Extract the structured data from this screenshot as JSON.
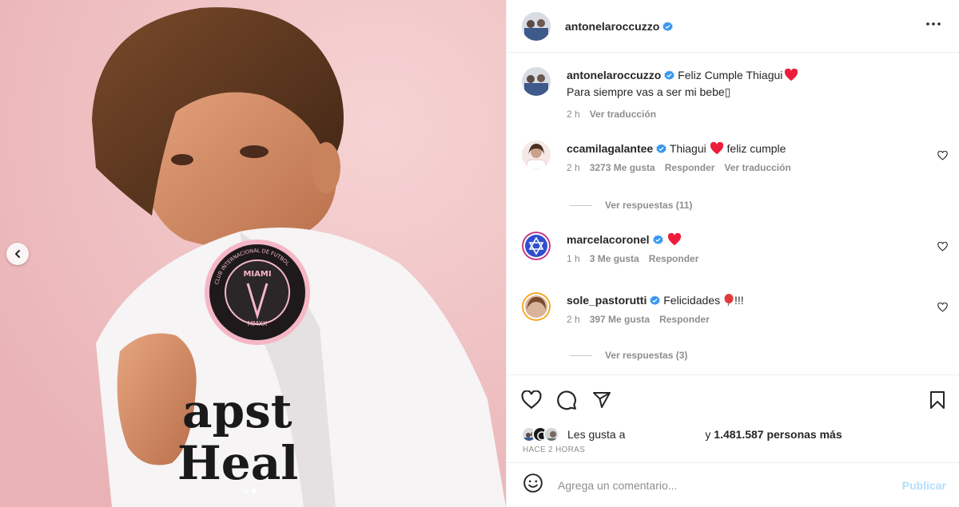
{
  "header": {
    "username": "antonelaroccuzzo",
    "verified": true,
    "more_icon": "more-horizontal-icon"
  },
  "caption": {
    "username": "antonelaroccuzzo",
    "text_line1": "Feliz Cumple Thiagui",
    "text_line2": "Para siempre vas a ser mi bebe▯",
    "time": "2 h",
    "translate": "Ver traducción"
  },
  "comments": [
    {
      "username": "ccamilagalantee",
      "text_pre": "Thiagui",
      "text_post": "feliz cumple",
      "time": "2 h",
      "likes": "3273 Me gusta",
      "reply": "Responder",
      "translate": "Ver traducción",
      "replies": "Ver respuestas (11)"
    },
    {
      "username": "marcelacoronel",
      "text_pre": "",
      "text_post": "",
      "time": "1 h",
      "likes": "3 Me gusta",
      "reply": "Responder"
    },
    {
      "username": "sole_pastorutti",
      "text_pre": "Felicidades",
      "text_post": "!!!",
      "time": "2 h",
      "likes": "397 Me gusta",
      "reply": "Responder",
      "replies": "Ver respuestas (3)"
    }
  ],
  "likes": {
    "prefix": "Les gusta a",
    "suffix": "y",
    "count": "1.481.587 personas más"
  },
  "timeago": "HACE 2 HORAS",
  "comment_box": {
    "placeholder": "Agrega un comentario...",
    "publish": "Publicar"
  },
  "media": {
    "shirt_text_line1": "apst",
    "shirt_text_line2": "Heal",
    "badge_top": "CLUB INTERNACIONAL DE FUTBOL",
    "badge_city": "MIAMI",
    "badge_year": "MMXX",
    "carousel_index": 2,
    "carousel_total": 2
  },
  "colors": {
    "verified": "#3897f0",
    "heart_red": "#ed1c3b",
    "link_disabled": "#b2dffc",
    "background_pink": "#f2c5c7"
  }
}
